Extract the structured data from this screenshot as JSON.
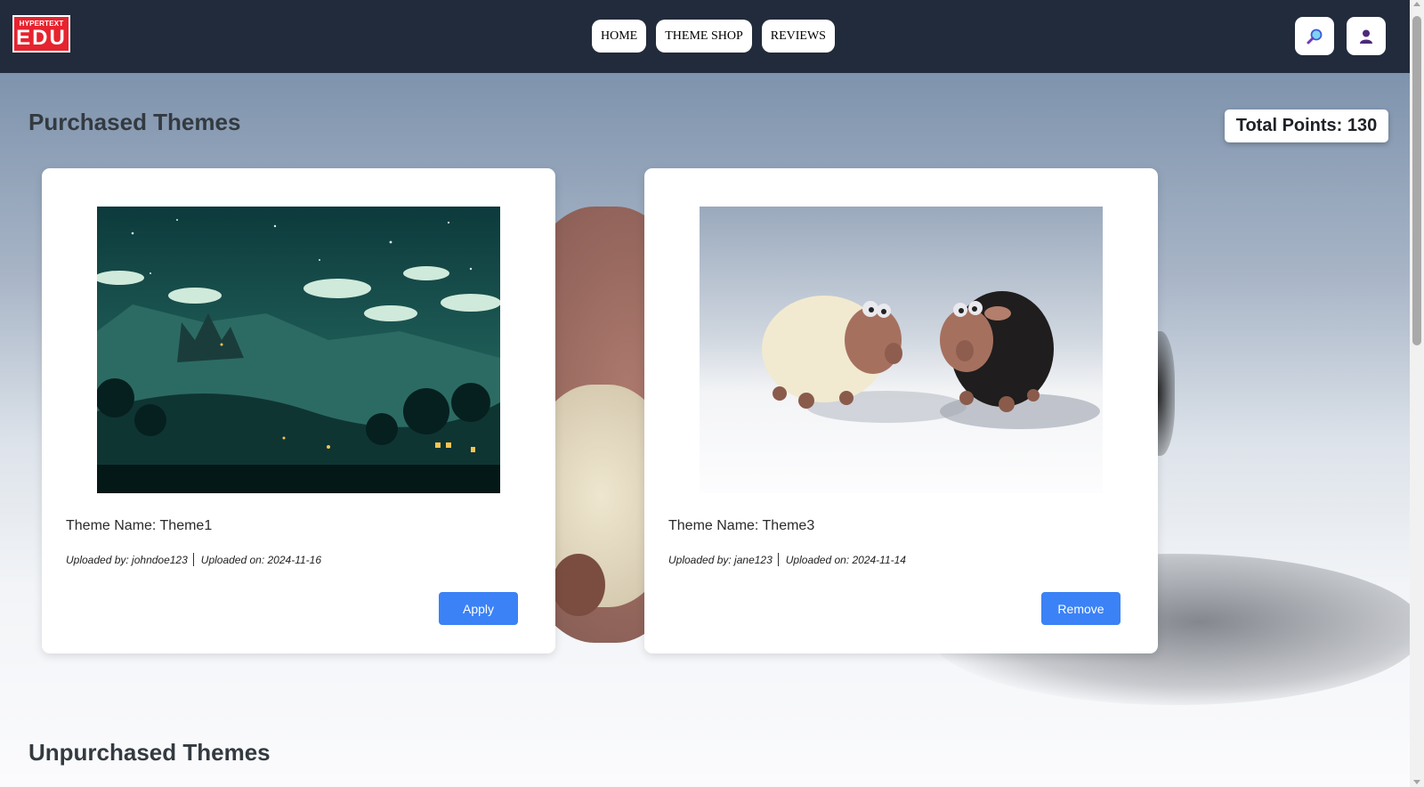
{
  "header": {
    "logo_top": "HYPERTEXT",
    "logo_bottom": "EDU",
    "nav": [
      "HOME",
      "THEME SHOP",
      "REVIEWS"
    ],
    "search_icon": "search-icon",
    "profile_icon": "user-profile-icon"
  },
  "points": {
    "label": "Total Points: 130"
  },
  "purchased": {
    "title": "Purchased Themes",
    "cards": [
      {
        "name": "Theme Name: Theme1",
        "uploader": "Uploaded by: johndoe123",
        "date": "Uploaded on: 2024-11-16",
        "button": "Apply",
        "image": "night-castle-landscape"
      },
      {
        "name": "Theme Name: Theme3",
        "uploader": "Uploaded by: jane123",
        "date": "Uploaded on: 2024-11-14",
        "button": "Remove",
        "image": "two-sheep"
      }
    ]
  },
  "unpurchased": {
    "title": "Unpurchased Themes"
  },
  "colors": {
    "header_bg": "#222b3b",
    "accent_button": "#3b82f6",
    "logo_red": "#e7232f"
  }
}
